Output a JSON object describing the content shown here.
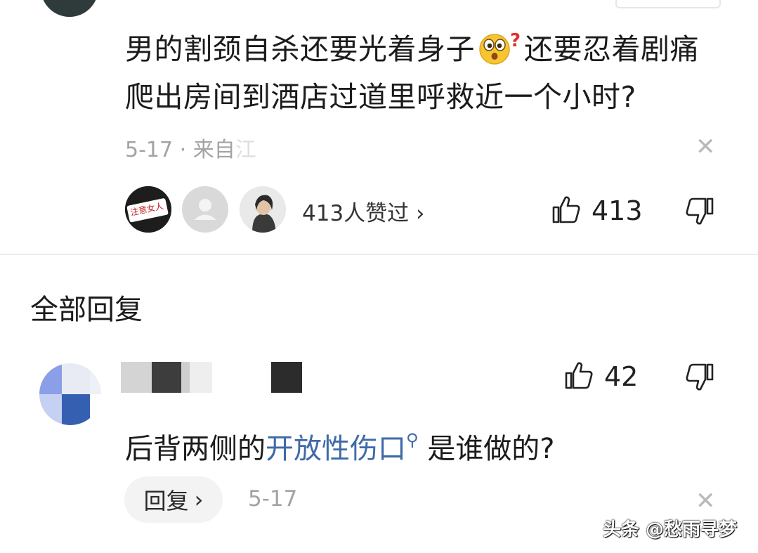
{
  "top_comment": {
    "text_part1": "男的割颈自杀还要光着身子",
    "text_part2": "还要忍着剧痛爬出房间到酒店过道里呼救近一个小时?",
    "emoji_icon": "surprised-question-emoji",
    "meta_date": "5-17",
    "meta_sep": "·",
    "meta_source": "来自",
    "meta_source_faded": "江",
    "liker1_badge": "注意女人",
    "likes_summary": "413人赞过",
    "likes_chevron": "›",
    "like_count": "413",
    "close_symbol": "✕"
  },
  "section": {
    "title": "全部回复"
  },
  "reply": {
    "text_before": "后背两侧的",
    "link_text": "开放性伤口",
    "link_icon": "search-icon",
    "link_icon_glyph": "⚲",
    "text_after": "是谁做的?",
    "like_count": "42",
    "reply_button_label": "回复",
    "reply_button_chevron": "›",
    "date": "5-17",
    "close_symbol": "✕"
  },
  "watermark": "头条 @愁雨寻梦",
  "colors": {
    "link": "#3f6aa8",
    "meta": "#a3a3a3",
    "divider": "#ececec",
    "reply_button_bg": "#f3f3f3"
  }
}
